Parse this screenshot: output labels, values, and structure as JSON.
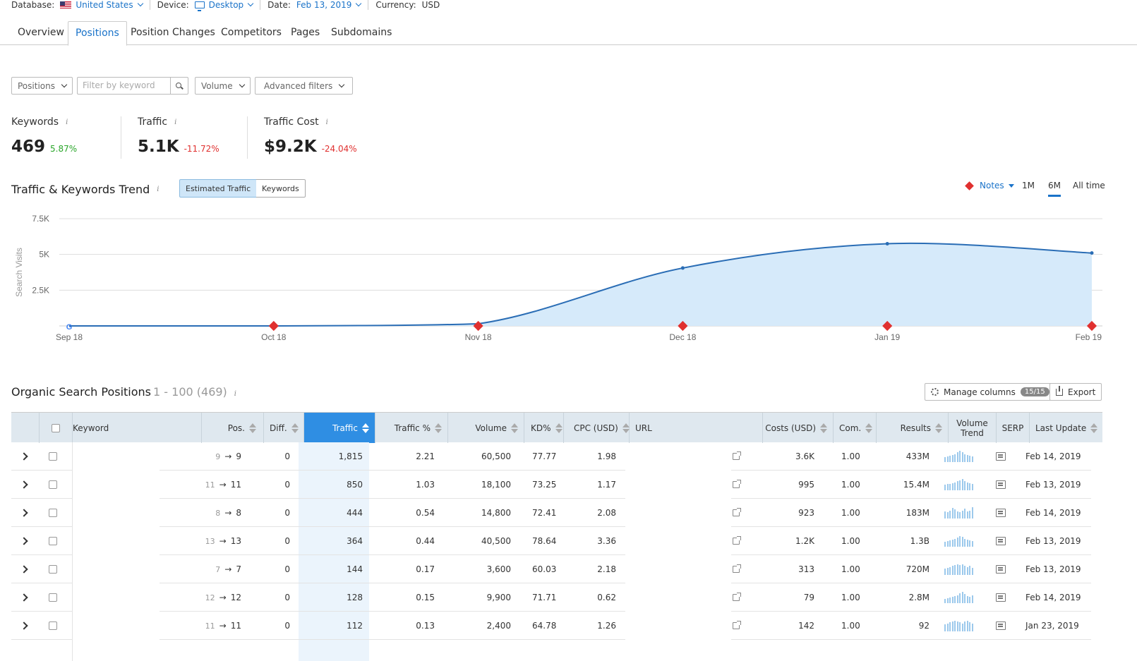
{
  "meta": {
    "database_label": "Database:",
    "database_value": "United States",
    "device_label": "Device:",
    "device_value": "Desktop",
    "date_label": "Date:",
    "date_value": "Feb 13, 2019",
    "currency_label": "Currency:",
    "currency_value": "USD"
  },
  "tabs": [
    "Overview",
    "Positions",
    "Position Changes",
    "Competitors",
    "Pages",
    "Subdomains"
  ],
  "active_tab": "Positions",
  "filters": {
    "positions": "Positions",
    "keyword_placeholder": "Filter by keyword",
    "volume": "Volume",
    "advanced": "Advanced filters"
  },
  "kpis": [
    {
      "title": "Keywords",
      "value": "469",
      "change": "5.87%"
    },
    {
      "title": "Traffic",
      "value": "5.1K",
      "change": "-11.72%"
    },
    {
      "title": "Traffic Cost",
      "value": "$9.2K",
      "change": "-24.04%"
    }
  ],
  "trend": {
    "title": "Traffic & Keywords Trend",
    "toggle_on": "Estimated Traffic",
    "toggle_off": "Keywords",
    "notes": "Notes",
    "ranges": [
      "1M",
      "6M",
      "All time"
    ],
    "active_range": "6M"
  },
  "chart_data": {
    "type": "area",
    "ylabel": "Search Visits",
    "y_ticks": [
      "7.5K",
      "5K",
      "2.5K"
    ],
    "ylim": [
      0,
      7500
    ],
    "categories": [
      "Sep 18",
      "Oct 18",
      "Nov 18",
      "Dec 18",
      "Jan 19",
      "Feb 19"
    ],
    "series": [
      {
        "values": [
          0,
          0,
          150,
          4050,
          5750,
          5100
        ]
      }
    ],
    "note_markers": [
      "Oct 18",
      "Nov 18",
      "Dec 18",
      "Jan 19",
      "Feb 19"
    ],
    "grid": true,
    "color": "#2a6db5",
    "fill": "#d6eafa"
  },
  "table": {
    "title": "Organic Search Positions",
    "range": "1 - 100 (469)",
    "manage_columns": "Manage columns",
    "columns_badge": "15/15",
    "export": "Export",
    "headers": {
      "keyword": "Keyword",
      "pos": "Pos.",
      "diff": "Diff.",
      "traffic": "Traffic",
      "traffic_pct": "Traffic %",
      "volume": "Volume",
      "kd": "KD%",
      "cpc": "CPC (USD)",
      "url": "URL",
      "costs": "Costs (USD)",
      "com": "Com.",
      "results": "Results",
      "volume_trend_1": "Volume",
      "volume_trend_2": "Trend",
      "serp": "SERP",
      "last_update": "Last Update"
    },
    "rows": [
      {
        "pos_from": "9",
        "pos_to": "9",
        "diff": "0",
        "traffic": "1,815",
        "traffic_pct": "2.21",
        "volume": "60,500",
        "kd": "77.77",
        "cpc": "1.98",
        "costs": "3.6K",
        "com": "1.00",
        "results": "433M",
        "trend": [
          6,
          7,
          8,
          9,
          10,
          12,
          14,
          12,
          10,
          9,
          8,
          7
        ],
        "last_update": "Feb 14, 2019"
      },
      {
        "pos_from": "11",
        "pos_to": "11",
        "diff": "0",
        "traffic": "850",
        "traffic_pct": "1.03",
        "volume": "18,100",
        "kd": "73.25",
        "cpc": "1.17",
        "costs": "995",
        "com": "1.00",
        "results": "15.4M",
        "trend": [
          7,
          8,
          8,
          9,
          10,
          11,
          12,
          14,
          11,
          10,
          9,
          8
        ],
        "last_update": "Feb 13, 2019"
      },
      {
        "pos_from": "8",
        "pos_to": "8",
        "diff": "0",
        "traffic": "444",
        "traffic_pct": "0.54",
        "volume": "14,800",
        "kd": "72.41",
        "cpc": "2.08",
        "costs": "923",
        "com": "1.00",
        "results": "183M",
        "trend": [
          9,
          8,
          10,
          13,
          11,
          9,
          8,
          10,
          12,
          9,
          10,
          14
        ],
        "last_update": "Feb 14, 2019"
      },
      {
        "pos_from": "13",
        "pos_to": "13",
        "diff": "0",
        "traffic": "364",
        "traffic_pct": "0.44",
        "volume": "40,500",
        "kd": "78.64",
        "cpc": "3.36",
        "costs": "1.2K",
        "com": "1.00",
        "results": "1.3B",
        "trend": [
          6,
          7,
          8,
          9,
          10,
          11,
          13,
          12,
          10,
          9,
          8,
          7
        ],
        "last_update": "Feb 13, 2019"
      },
      {
        "pos_from": "7",
        "pos_to": "7",
        "diff": "0",
        "traffic": "144",
        "traffic_pct": "0.17",
        "volume": "3,600",
        "kd": "60.03",
        "cpc": "2.18",
        "costs": "313",
        "com": "1.00",
        "results": "720M",
        "trend": [
          8,
          9,
          10,
          11,
          12,
          13,
          12,
          13,
          11,
          10,
          11,
          9
        ],
        "last_update": "Feb 13, 2019"
      },
      {
        "pos_from": "12",
        "pos_to": "12",
        "diff": "0",
        "traffic": "128",
        "traffic_pct": "0.15",
        "volume": "9,900",
        "kd": "71.71",
        "cpc": "0.62",
        "costs": "79",
        "com": "1.00",
        "results": "2.8M",
        "trend": [
          5,
          6,
          7,
          8,
          9,
          10,
          12,
          14,
          11,
          9,
          8,
          10
        ],
        "last_update": "Feb 14, 2019"
      },
      {
        "pos_from": "11",
        "pos_to": "11",
        "diff": "0",
        "traffic": "112",
        "traffic_pct": "0.13",
        "volume": "2,400",
        "kd": "64.78",
        "cpc": "1.26",
        "costs": "142",
        "com": "1.00",
        "results": "92",
        "trend": [
          9,
          10,
          11,
          12,
          13,
          12,
          11,
          10,
          12,
          13,
          11,
          10
        ],
        "last_update": "Jan 23, 2019"
      }
    ]
  }
}
